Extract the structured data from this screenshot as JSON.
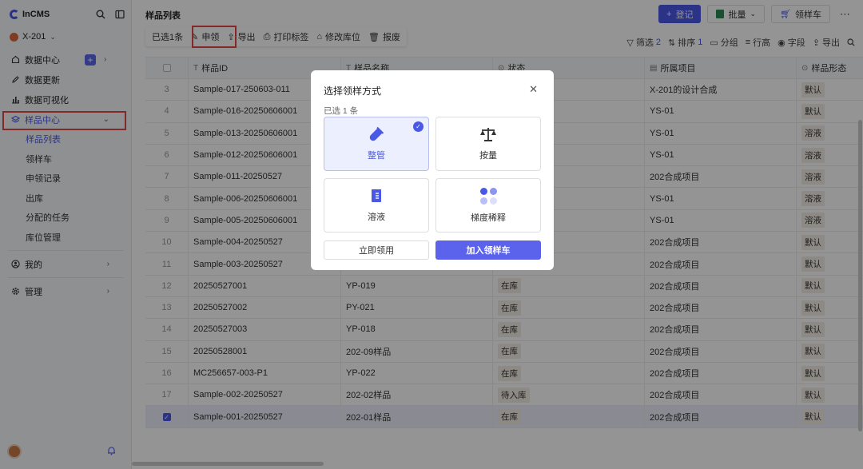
{
  "app": {
    "name": "InCMS",
    "project": "X-201"
  },
  "sidebar": {
    "items": [
      {
        "label": "数据中心"
      },
      {
        "label": "数据更新"
      },
      {
        "label": "数据可视化"
      },
      {
        "label": "样品中心"
      }
    ],
    "sub_items": [
      {
        "label": "样品列表"
      },
      {
        "label": "领样车"
      },
      {
        "label": "申领记录"
      },
      {
        "label": "出库"
      },
      {
        "label": "分配的任务"
      },
      {
        "label": "库位管理"
      }
    ],
    "mine": "我的",
    "manage": "管理"
  },
  "header": {
    "title": "样品列表",
    "register": "登记",
    "batch": "批量",
    "cart": "领样车"
  },
  "selection_bar": {
    "selected": "已选1条",
    "apply": "申领",
    "export": "导出",
    "print": "打印标签",
    "change_location": "修改库位",
    "scrap": "报废"
  },
  "view_tools": {
    "filter": "筛选",
    "filter_count": "2",
    "sort": "排序",
    "sort_count": "1",
    "group": "分组",
    "row_height": "行高",
    "fields": "字段",
    "export": "导出"
  },
  "table": {
    "columns": [
      "样品ID",
      "样品名称",
      "状态",
      "所属项目",
      "样品形态"
    ],
    "rows": [
      {
        "no": "3",
        "id": "Sample-017-250603-011",
        "name": "",
        "status": "",
        "project": "X-201的设计合成",
        "form": "默认"
      },
      {
        "no": "4",
        "id": "Sample-016-20250606001",
        "name": "",
        "status": "",
        "project": "YS-01",
        "form": "默认"
      },
      {
        "no": "5",
        "id": "Sample-013-20250606001",
        "name": "",
        "status": "",
        "project": "YS-01",
        "form": "溶液"
      },
      {
        "no": "6",
        "id": "Sample-012-20250606001",
        "name": "",
        "status": "",
        "project": "YS-01",
        "form": "溶液"
      },
      {
        "no": "7",
        "id": "Sample-011-20250527",
        "name": "",
        "status": "",
        "project": "202合成项目",
        "form": "溶液"
      },
      {
        "no": "8",
        "id": "Sample-006-20250606001",
        "name": "",
        "status": "",
        "project": "YS-01",
        "form": "溶液"
      },
      {
        "no": "9",
        "id": "Sample-005-20250606001",
        "name": "",
        "status": "",
        "project": "YS-01",
        "form": "溶液"
      },
      {
        "no": "10",
        "id": "Sample-004-20250527",
        "name": "",
        "status": "",
        "project": "202合成项目",
        "form": "默认"
      },
      {
        "no": "11",
        "id": "Sample-003-20250527",
        "name": "",
        "status": "",
        "project": "202合成项目",
        "form": "默认"
      },
      {
        "no": "12",
        "id": "20250527001",
        "name": "YP-019",
        "status": "在库",
        "project": "202合成项目",
        "form": "默认"
      },
      {
        "no": "13",
        "id": "20250527002",
        "name": "PY-021",
        "status": "在库",
        "project": "202合成项目",
        "form": "默认"
      },
      {
        "no": "14",
        "id": "20250527003",
        "name": "YP-018",
        "status": "在库",
        "project": "202合成项目",
        "form": "默认"
      },
      {
        "no": "15",
        "id": "20250528001",
        "name": "202-09样品",
        "status": "在库",
        "project": "202合成项目",
        "form": "默认"
      },
      {
        "no": "16",
        "id": "MC256657-003-P1",
        "name": "YP-022",
        "status": "在库",
        "project": "202合成项目",
        "form": "默认"
      },
      {
        "no": "17",
        "id": "Sample-002-20250527",
        "name": "202-02样品",
        "status": "待入库",
        "project": "202合成项目",
        "form": "默认"
      },
      {
        "no": "",
        "id": "Sample-001-20250527",
        "name": "202-01样品",
        "status": "在库",
        "project": "202合成项目",
        "form": "默认"
      }
    ]
  },
  "modal": {
    "title": "选择领样方式",
    "count": "已选 1 条",
    "options": [
      {
        "label": "整管"
      },
      {
        "label": "按量"
      },
      {
        "label": "溶液"
      },
      {
        "label": "梯度稀释"
      }
    ],
    "apply_now": "立即领用",
    "add_to_cart": "加入领样车"
  },
  "colors": {
    "accent": "#4a58e8",
    "highlight": "#e64545",
    "tag_bg": "#f3ede3"
  }
}
